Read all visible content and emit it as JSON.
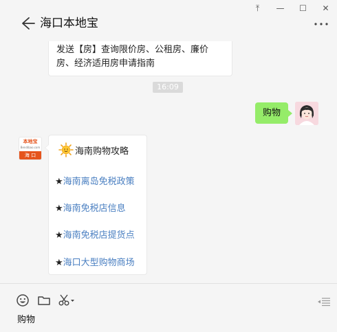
{
  "window": {
    "controls": {
      "pin": "⤒",
      "minimize": "—",
      "maximize": "☐",
      "close": "✕"
    }
  },
  "header": {
    "title": "海口本地宝",
    "back_icon": "back-arrow-icon",
    "more_icon": "more-dots-icon"
  },
  "messages": {
    "previous": {
      "line1": "发送【房】查询限价房、公租房、廉价",
      "line2": "房、经济适用房申请指南"
    },
    "timestamp": "16:09",
    "outgoing": {
      "text": "购物",
      "avatar": "user-avatar"
    },
    "incoming": {
      "avatar": {
        "top": "本地宝",
        "sub": "Bendibao.com",
        "bottom": "海 口"
      },
      "card": {
        "icon": "sun-icon",
        "title": "海南购物攻略",
        "links": [
          {
            "star": "★",
            "label": "海南离岛免税政策"
          },
          {
            "star": "★",
            "label": "海南免税店信息"
          },
          {
            "star": "★",
            "label": "海南免税店提货点"
          },
          {
            "star": "★",
            "label": "海口大型购物商场"
          }
        ]
      }
    }
  },
  "input": {
    "toolbar": [
      "emoji-icon",
      "folder-icon",
      "scissors-icon"
    ],
    "text": "购物",
    "send_icon": "send-icon"
  },
  "colors": {
    "out_bubble": "#95ec69",
    "link": "#4a7fc1",
    "brand": "#e5541c",
    "background": "#f5f5f5"
  }
}
